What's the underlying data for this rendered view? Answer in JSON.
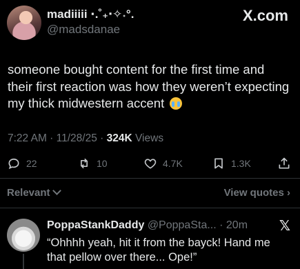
{
  "post": {
    "display_name": "madiiiii ⋅.˚₊‧✧˖°.",
    "handle": "@madsdanae",
    "brand": "X.com",
    "text": "someone bought content for the first time and their first reaction was how they weren’t expecting my thick midwestern accent",
    "emoji": "crying-face",
    "time": "7:22 AM",
    "date": "11/28/25",
    "views_count": "324K",
    "views_label": "Views"
  },
  "actions": {
    "replies": "22",
    "reposts": "10",
    "likes": "4.7K",
    "bookmarks": "1.3K"
  },
  "sort": {
    "relevant_label": "Relevant",
    "view_quotes_label": "View quotes"
  },
  "reply": {
    "display_name": "PoppaStankDaddy",
    "handle": "@PoppaSta...",
    "time": "20m",
    "text": "“Ohhhh yeah, hit it from the bayck! Hand me that pellow over there... Ope!”"
  },
  "colors": {
    "background": "#000000",
    "text": "#e7e9ea",
    "muted": "#71767b",
    "divider": "#2f3336"
  }
}
